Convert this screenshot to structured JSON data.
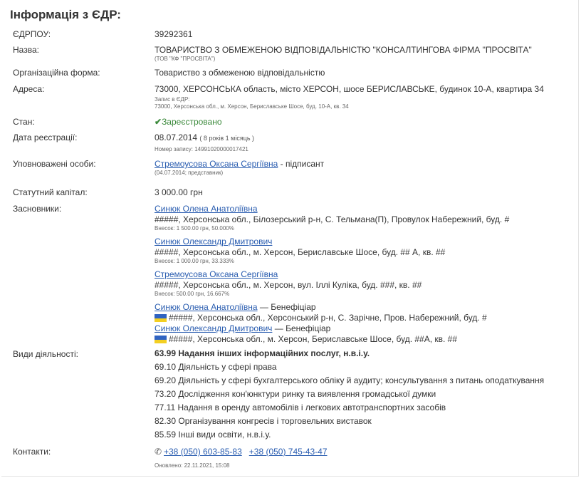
{
  "header": {
    "title": "Інформація з ЄДР:"
  },
  "edrpou": {
    "label": "ЄДРПОУ:",
    "value": "39292361"
  },
  "name": {
    "label": "Назва:",
    "full": "ТОВАРИСТВО З ОБМЕЖЕНОЮ ВІДПОВІДАЛЬНІСТЮ \"КОНСАЛТИНГОВА ФІРМА \"ПРОСВІТА\"",
    "short": "(ТОВ \"КФ \"ПРОСВІТА\")"
  },
  "org_form": {
    "label": "Організаційна форма:",
    "value": "Товариство з обмеженою відповідальністю"
  },
  "address": {
    "label": "Адреса:",
    "value": "73000, ХЕРСОНСЬКА область, місто ХЕРСОН, шосе БЕРИСЛАВСЬКЕ, будинок 10-А, квартира 34",
    "note_title": "Запис в ЄДР:",
    "note_value": "73000, Херсонська обл., м. Херсон, Бериславське Шосе, буд. 10-А, кв. 34"
  },
  "status": {
    "label": "Стан:",
    "value": "Зареєстровано",
    "icon": "check-icon",
    "color": "#3c8a3c"
  },
  "registration": {
    "label": "Дата реєстрації:",
    "date": "08.07.2014",
    "age": "( 8 років 1 місяць )",
    "record": "Номер запису: 14991020000017421"
  },
  "authorized": {
    "label": "Уповноважені особи:",
    "person": "Стремоусова Оксана Сергіївна",
    "role": " - підписант",
    "note": "(04.07.2014; представник)"
  },
  "capital": {
    "label": "Статутний капітал:",
    "value": "3 000.00 грн"
  },
  "founders": {
    "label": "Засновники:",
    "items": [
      {
        "name": "Синюк Олена Анатоліївна",
        "address": "#####, Херсонська обл., Білозерський р-н, С. Тельмана(П), Провулок Набережний, буд. #",
        "share": "Внесок: 1 500.00 грн, 50.000%"
      },
      {
        "name": "Синюк Олександр Дмитрович",
        "address": "#####, Херсонська обл., м. Херсон, Бериславське Шосе, буд. ## А, кв. ##",
        "share": "Внесок: 1 000.00 грн, 33.333%"
      },
      {
        "name": "Стремоусова Оксана Сергіївна",
        "address": "#####, Херсонська обл., м. Херсон, вул. Іллі Куліка, буд. ###, кв. ##",
        "share": "Внесок: 500.00 грн, 16.667%"
      }
    ],
    "beneficiaries": [
      {
        "name": "Синюк Олена Анатоліївна",
        "role": " — Бенефіціар",
        "flag": "ua-flag-icon",
        "address": "#####, Херсонська обл., Херсонський р-н, С. Зарічне, Пров. Набережний, буд. #"
      },
      {
        "name": "Синюк Олександр Дмитрович",
        "role": " — Бенефіціар",
        "flag": "ua-flag-icon",
        "address": "#####, Херсонська обл., м. Херсон, Бериславське Шосе, буд. ##А, кв. ##"
      }
    ]
  },
  "activities": {
    "label": "Види діяльності:",
    "items": [
      "63.99 Надання інших інформаційних послуг, н.в.і.у.",
      "69.10 Діяльність у сфері права",
      "69.20 Діяльність у сфері бухгалтерського обліку й аудиту; консультування з питань оподаткування",
      "73.20 Дослідження кон'юнктури ринку та виявлення громадської думки",
      "77.11 Надання в оренду автомобілів і легкових автотранспортних засобів",
      "82.30 Організування конгресів і торговельних виставок",
      "85.59 Інші види освіти, н.в.і.у."
    ]
  },
  "contacts": {
    "label": "Контакти:",
    "icon": "phone-icon",
    "phones": [
      "+38 (050) 603-85-83",
      "+38 (050) 745-43-47"
    ],
    "updated": "Оновлено: 22.11.2021, 15:08"
  },
  "colors": {
    "link": "#2a5db0",
    "flag_blue": "#2f63c2",
    "flag_yellow": "#f3cf22"
  }
}
